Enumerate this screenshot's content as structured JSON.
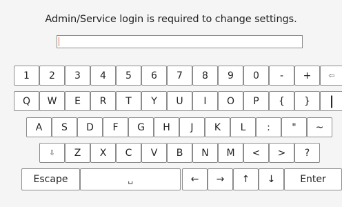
{
  "prompt": "Admin/Service login is required to change settings.",
  "password_field": {
    "value": ""
  },
  "keyboard": {
    "row1": [
      "1",
      "2",
      "3",
      "4",
      "5",
      "6",
      "7",
      "8",
      "9",
      "0",
      "-",
      "+",
      "⇦"
    ],
    "row2": [
      "Q",
      "W",
      "E",
      "R",
      "T",
      "Y",
      "U",
      "I",
      "O",
      "P",
      "{",
      "}",
      "|"
    ],
    "row3": [
      "A",
      "S",
      "D",
      "F",
      "G",
      "H",
      "J",
      "K",
      "L",
      ":",
      "\"",
      "~"
    ],
    "row4": [
      "⇩",
      "Z",
      "X",
      "C",
      "V",
      "B",
      "N",
      "M",
      "<",
      ">",
      "?"
    ],
    "row5": {
      "escape": "Escape",
      "space": "␣",
      "left": "←",
      "right": "→",
      "up": "↑",
      "down": "↓",
      "enter": "Enter"
    }
  },
  "colors": {
    "background": "#f5f5f5",
    "key_fill": "#ffffff",
    "key_border": "#8b8b8b",
    "caret": "#e26b2a"
  }
}
